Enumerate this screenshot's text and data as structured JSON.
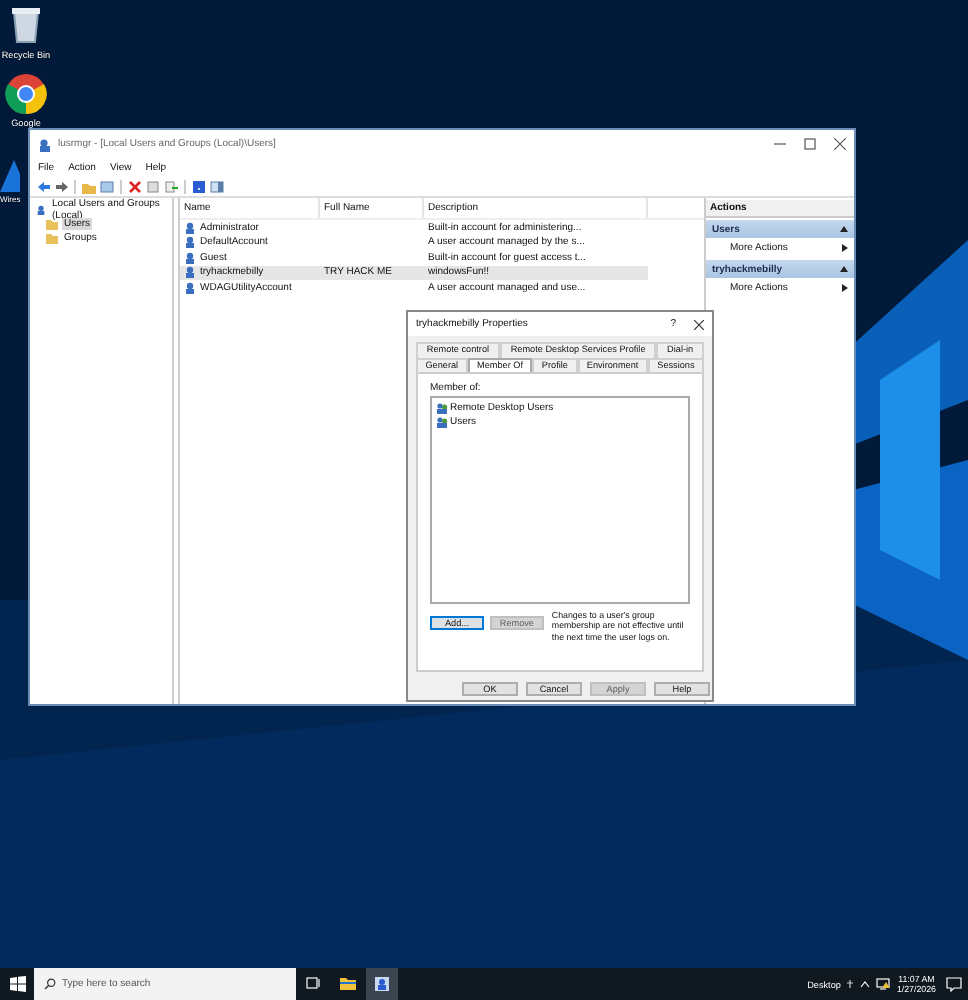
{
  "desktop_icons": [
    {
      "label": "Recycle Bin",
      "kind": "bin"
    },
    {
      "label": "Google",
      "kind": "browser"
    },
    {
      "label": "Wires",
      "kind": "fin"
    }
  ],
  "window": {
    "title": "lusrmgr - [Local Users and Groups (Local)\\Users]",
    "menu": [
      "File",
      "Action",
      "View",
      "Help"
    ],
    "tree": {
      "label": "Local Users and Groups (Local)",
      "children": [
        {
          "label": "Users",
          "selected": true
        },
        {
          "label": "Groups",
          "selected": false
        }
      ]
    },
    "columns": [
      "Name",
      "Full Name",
      "Description"
    ],
    "rows": [
      {
        "name": "Administrator",
        "full_name": "",
        "description": "Built-in account for administering...",
        "selected": false
      },
      {
        "name": "DefaultAccount",
        "full_name": "",
        "description": "A user account managed by the s...",
        "selected": false
      },
      {
        "name": "Guest",
        "full_name": "",
        "description": "Built-in account for guest access t...",
        "selected": false
      },
      {
        "name": "tryhackmebilly",
        "full_name": "TRY HACK ME",
        "description": "windowsFun!!",
        "selected": true
      },
      {
        "name": "WDAGUtilityAccount",
        "full_name": "",
        "description": "A user account managed and use...",
        "selected": false
      }
    ],
    "actions": {
      "header": "Actions",
      "sections": [
        {
          "title": "Users",
          "items": [
            "More Actions"
          ]
        },
        {
          "title": "tryhackmebilly",
          "items": [
            "More Actions"
          ]
        }
      ]
    }
  },
  "dialog": {
    "title": "tryhackmebilly Properties",
    "help_glyph": "?",
    "tab_rows": [
      [
        {
          "label": "Remote control",
          "selected": false
        },
        {
          "label": "Remote Desktop Services Profile",
          "selected": false
        },
        {
          "label": "Dial-in",
          "selected": false
        }
      ],
      [
        {
          "label": "General",
          "selected": false
        },
        {
          "label": "Member Of",
          "selected": true
        },
        {
          "label": "Profile",
          "selected": false
        },
        {
          "label": "Environment",
          "selected": false
        },
        {
          "label": "Sessions",
          "selected": false
        }
      ]
    ],
    "member_of_label": "Member of:",
    "members": [
      "Remote Desktop Users",
      "Users"
    ],
    "buttons": [
      {
        "label": "Add...",
        "disabled": false
      },
      {
        "label": "Remove",
        "disabled": true
      }
    ],
    "note": "Changes to a user's group membership are not effective until the next time the user logs on.",
    "footer_buttons": [
      {
        "label": "OK",
        "disabled": false
      },
      {
        "label": "Cancel",
        "disabled": false
      },
      {
        "label": "Apply",
        "disabled": true
      },
      {
        "label": "Help",
        "disabled": false
      }
    ]
  },
  "taskbar": {
    "search_placeholder": "Type here to search",
    "apps": [
      {
        "kind": "taskview",
        "selected": false
      },
      {
        "kind": "explorer",
        "selected": false
      },
      {
        "kind": "mmc",
        "selected": true
      }
    ],
    "desktop_label": "Desktop",
    "time": "11:07 AM",
    "date": "1/27/2026"
  }
}
